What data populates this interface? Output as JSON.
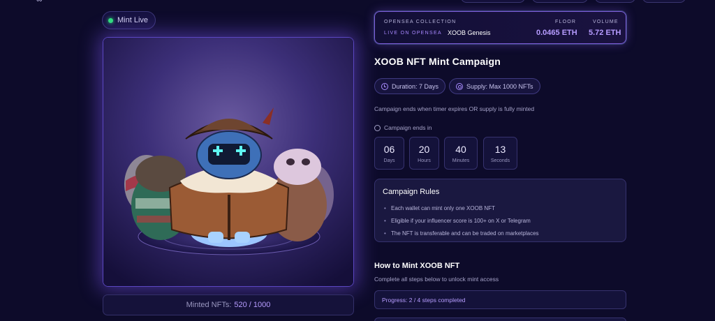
{
  "header": {
    "logo_fragment": "∞"
  },
  "status": {
    "mint_live_label": "Mint Live"
  },
  "nft": {
    "minted_label": "Minted NFTs:",
    "minted_value": "520 / 1000"
  },
  "collection": {
    "label": "OPENSEA COLLECTION",
    "live_label": "LIVE ON OPENSEA",
    "name": "XOOB Genesis",
    "floor_label": "FLOOR",
    "floor_value": "0.0465 ETH",
    "volume_label": "VOLUME",
    "volume_value": "5.72 ETH"
  },
  "campaign": {
    "title": "XOOB NFT Mint Campaign",
    "duration": "Duration: 7 Days",
    "supply": "Supply: Max 1000 NFTs",
    "ends_note": "Campaign ends when timer expires OR supply is fully minted",
    "ends_in_label": "Campaign ends in",
    "countdown": [
      {
        "value": "06",
        "unit": "Days"
      },
      {
        "value": "20",
        "unit": "Hours"
      },
      {
        "value": "40",
        "unit": "Minutes"
      },
      {
        "value": "13",
        "unit": "Seconds"
      }
    ]
  },
  "rules": {
    "title": "Campaign Rules",
    "items": [
      "Each wallet can mint only one XOOB NFT",
      "Eligible if your influencer score is 100+ on X or Telegram",
      "The NFT is transferable and can be traded on marketplaces"
    ]
  },
  "howto": {
    "title": "How to Mint XOOB NFT",
    "subtitle": "Complete all steps below to unlock mint access",
    "progress_text": "Progress: 2 / 4 steps completed",
    "steps_completed": 2,
    "steps_total": 4
  },
  "colors": {
    "accent": "#b69cff",
    "live": "#2fe07b",
    "background": "#0d0b2a"
  },
  "icons": {
    "duration": "clock-icon",
    "supply": "database-icon",
    "ends_in": "clock-icon"
  }
}
